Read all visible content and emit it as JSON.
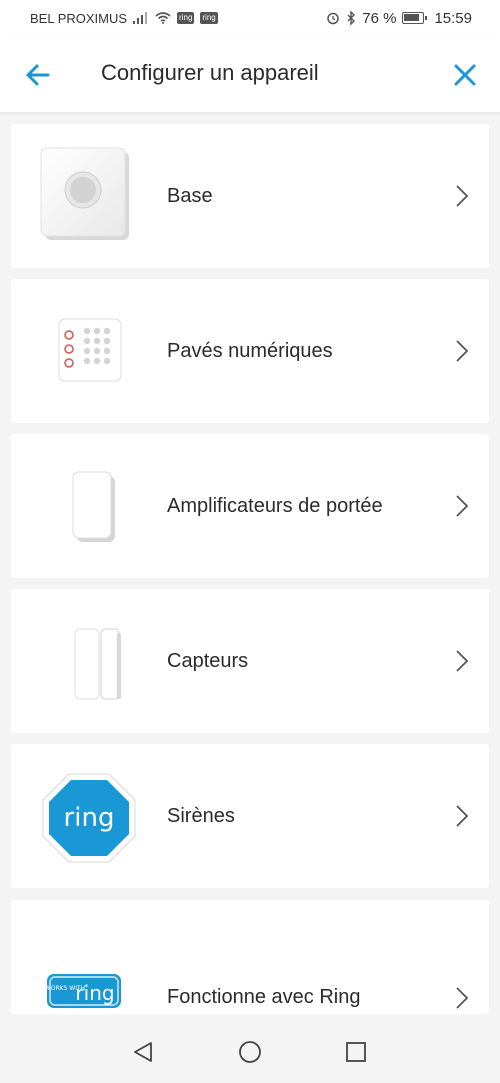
{
  "status_bar": {
    "carrier": "BEL PROXIMUS",
    "badge_1": "ring",
    "badge_2": "ring",
    "battery_percent": "76 %",
    "time": "15:59"
  },
  "header": {
    "title": "Configurer un appareil",
    "back_icon": "arrow-left-icon",
    "close_icon": "close-icon"
  },
  "devices": [
    {
      "label": "Base",
      "icon": "base-station-icon"
    },
    {
      "label": "Pavés numériques",
      "icon": "keypad-icon"
    },
    {
      "label": "Amplificateurs de portée",
      "icon": "range-extender-icon"
    },
    {
      "label": "Capteurs",
      "icon": "contact-sensor-icon"
    },
    {
      "label": "Sirènes",
      "icon": "ring-siren-icon",
      "logo_text": "ring"
    },
    {
      "label": "Fonctionne avec Ring",
      "icon": "works-with-ring-icon",
      "logo_small": "WORKS WITH",
      "logo_text": "ring"
    }
  ],
  "colors": {
    "accent": "#1998d5",
    "background": "#f4f4f4",
    "card": "#ffffff",
    "text": "#2b2b2b"
  },
  "nav_bar": {
    "back": "triangle-back-icon",
    "home": "circle-home-icon",
    "recents": "square-recents-icon"
  }
}
